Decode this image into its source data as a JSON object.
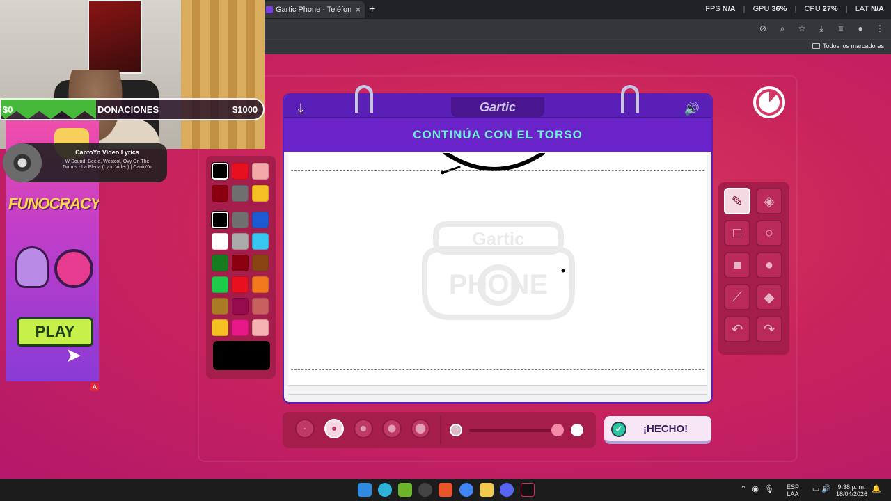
{
  "browser": {
    "tab_title": "Gartic Phone - Teléfono Descon",
    "tab_close": "×",
    "new_tab": "+",
    "perf": {
      "fps_label": "FPS",
      "fps_value": "N/A",
      "gpu_label": "GPU",
      "gpu_value": "36%",
      "cpu_label": "CPU",
      "cpu_value": "27%",
      "lat_label": "LAT",
      "lat_value": "N/A"
    },
    "bookmarks_all": "Todos los marcadores"
  },
  "stream": {
    "donation": {
      "min": "$0",
      "label": "DONACIONES",
      "max": "$1000"
    },
    "music": {
      "title": "CantoYo Video Lyrics",
      "subtitle": "W Sound, Beéle, Westcol, Ovy On The Drums - La Plena (Lyric Video) | CantoYo"
    },
    "ad": {
      "logo": "FUNOCRACY",
      "play": "PLAY",
      "badge": "A"
    }
  },
  "game": {
    "logo": "Gartic",
    "prompt": "CONTINÚA CON EL TORSO",
    "watermark_top": "Gartic",
    "watermark_bottom": "PHONE",
    "done_label": "¡HECHO!",
    "selected_tool": "pencil",
    "selected_color": "#000000",
    "palette": [
      [
        "#000000",
        "#e8101e",
        "#f4a9a9"
      ],
      [
        "#8a0010",
        "#6f6f6f",
        "#f5c021"
      ],
      [
        "#000000",
        "#6f6f6f",
        "#1c5ad1"
      ],
      [
        "#ffffff",
        "#aaaaaa",
        "#36c6f0"
      ],
      [
        "#167c1e",
        "#8a0010",
        "#8a4414"
      ],
      [
        "#1ec94a",
        "#e8101e",
        "#f27a1e"
      ],
      [
        "#ab7a24",
        "#950b4e",
        "#c86060"
      ],
      [
        "#f5c021",
        "#e81888",
        "#f6b2b2"
      ]
    ]
  },
  "taskbar": {
    "lang_1": "ESP",
    "lang_2": "LAA",
    "time": "9:38 p. m.",
    "date": "18/04/2026"
  }
}
